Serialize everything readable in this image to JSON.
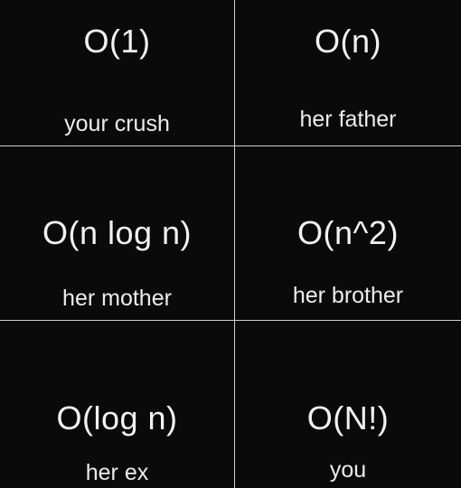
{
  "cells": [
    {
      "complexity": "O(1)",
      "label": "your crush"
    },
    {
      "complexity": "O(n)",
      "label": "her father"
    },
    {
      "complexity": "O(n log n)",
      "label": "her mother"
    },
    {
      "complexity": "O(n^2)",
      "label": "her brother"
    },
    {
      "complexity": "O(log n)",
      "label": "her ex"
    },
    {
      "complexity": "O(N!)",
      "label": "you"
    }
  ],
  "colors": {
    "background": "#0a0a0a",
    "text": "#f2f2f2",
    "grid_line": "#cfcfcf"
  }
}
